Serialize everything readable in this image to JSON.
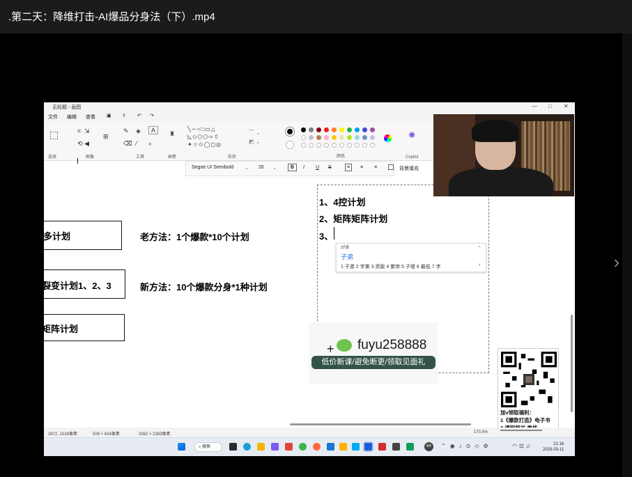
{
  "video": {
    "title": ".第二天：降维打击-AI爆品分身法（下）.mp4"
  },
  "paint": {
    "window_title": "无标题 - 画图",
    "menu": [
      "文件",
      "编辑",
      "查看"
    ],
    "ribbon_groups": [
      "选择",
      "图像",
      "工具",
      "画笔",
      "形状",
      "颜色",
      "Copilot"
    ],
    "font_name": "Segoe UI Semibold",
    "font_size": "26",
    "bg_fill_label": "背景填充",
    "status": {
      "cursor_pos": "2872, 1526像素",
      "selection_size": "509 × 634像素",
      "image_size": "3362 × 2383像素",
      "zoom": "170.5%"
    }
  },
  "canvas": {
    "box1": "多计划",
    "box2": "裂变计划1、2、3",
    "box3": "矩阵计划",
    "old_method": "老方法：1个爆款*10个计划",
    "new_method": "新方法：10个爆款分身*1种计划",
    "list": [
      "1、4控计划",
      "2、矩阵矩阵计划",
      "3、"
    ]
  },
  "ime": {
    "pinyin": "zi'di",
    "first": "子弟",
    "candidates": "1 子弟  2 字第  3 资敌  4 紫帝  5 子堤  6 最低  7 字"
  },
  "overlay": {
    "wechat_id": "fuyu258888",
    "slogan": "低价新课/避免断更/领取见面礼",
    "qr_line1": "加v领取福利：",
    "qr_line2": "1《爆款打造》电子书",
    "qr_line3": "2 课程相关 表格"
  },
  "taskbar": {
    "search": "搜索",
    "time": "21:16",
    "date": "2025-03-11",
    "badge": "64"
  },
  "colors": {
    "slogan_bg": "#2d4e45",
    "ime_candidate": "#1a6fd6",
    "topbar": "#1b1b1b"
  },
  "icons": [
    "chevron-right-icon",
    "wechat-icon",
    "qr-code-icon",
    "windows-start-icon",
    "search-icon"
  ]
}
